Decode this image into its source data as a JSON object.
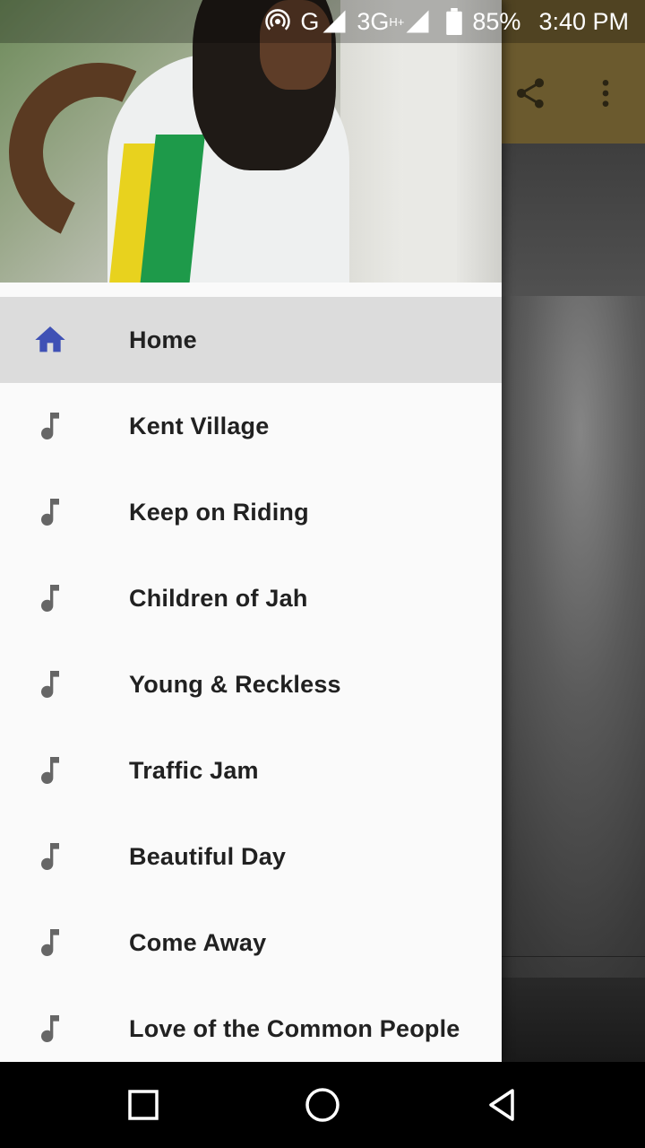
{
  "status_bar": {
    "network_type_1": "G",
    "network_type_2": "3G",
    "network_type_2_sup": "H+",
    "battery": "85%",
    "time": "3:40 PM"
  },
  "toolbar": {
    "icons": [
      "share-icon",
      "more-vert-icon"
    ]
  },
  "drawer": {
    "items": [
      {
        "label": "Home",
        "icon": "home-icon",
        "active": true
      },
      {
        "label": "Kent Village",
        "icon": "music-note-icon"
      },
      {
        "label": "Keep on Riding",
        "icon": "music-note-icon"
      },
      {
        "label": "Children of Jah",
        "icon": "music-note-icon"
      },
      {
        "label": "Young & Reckless",
        "icon": "music-note-icon"
      },
      {
        "label": "Traffic Jam",
        "icon": "music-note-icon"
      },
      {
        "label": "Beautiful Day",
        "icon": "music-note-icon"
      },
      {
        "label": "Come Away",
        "icon": "music-note-icon"
      },
      {
        "label": "Love of the Common People",
        "icon": "music-note-icon"
      }
    ]
  },
  "colors": {
    "accent": "#3f51b5",
    "icon_gray": "#666666",
    "active_bg": "#dcdcdc",
    "drawer_bg": "#fafafa",
    "toolbar_dim": "#6b5a2e"
  },
  "nav_bar": {
    "icons": [
      "recent-apps-icon",
      "home-circle-icon",
      "back-icon"
    ]
  }
}
